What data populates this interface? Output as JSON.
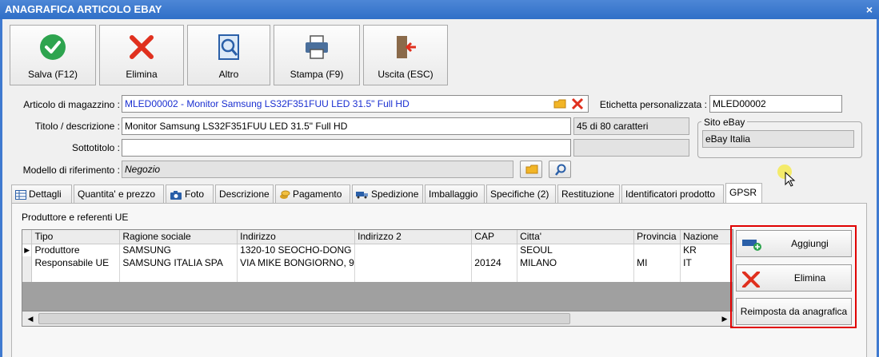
{
  "window": {
    "title": "ANAGRAFICA ARTICOLO EBAY",
    "close": "×"
  },
  "toolbar": {
    "save": "Salva (F12)",
    "delete": "Elimina",
    "other": "Altro",
    "print": "Stampa (F9)",
    "exit": "Uscita (ESC)"
  },
  "form": {
    "article_label": "Articolo di magazzino :",
    "article_value": "MLED00002 - Monitor Samsung LS32F351FUU LED 31.5\" Full HD",
    "custom_label_label": "Etichetta personalizzata :",
    "custom_label_value": "MLED00002",
    "title_label": "Titolo / descrizione :",
    "title_value": "Monitor Samsung LS32F351FUU LED 31.5\" Full HD",
    "char_count": "45 di 80 caratteri",
    "subtitle_label": "Sottotitolo :",
    "subtitle_value": "",
    "model_label": "Modello di riferimento :",
    "model_value": "Negozio",
    "site_group": "Sito eBay",
    "site_value": "eBay Italia"
  },
  "tabs": [
    "Dettagli",
    "Quantita' e prezzo",
    "Foto",
    "Descrizione",
    "Pagamento",
    "Spedizione",
    "Imballaggio",
    "Specifiche (2)",
    "Restituzione",
    "Identificatori prodotto",
    "GPSR"
  ],
  "gpsr": {
    "section_title": "Produttore e referenti UE",
    "columns": [
      "Tipo",
      "Ragione sociale",
      "Indirizzo",
      "Indirizzo 2",
      "CAP",
      "Citta'",
      "Provincia",
      "Nazione"
    ],
    "rows": [
      [
        "Produttore",
        "SAMSUNG",
        "1320-10 SEOCHO-DONG",
        "",
        "",
        "SEOUL",
        "",
        "KR"
      ],
      [
        "Responsabile UE",
        "SAMSUNG ITALIA SPA",
        "VIA MIKE BONGIORNO, 9",
        "",
        "20124",
        "MILANO",
        "MI",
        "IT"
      ]
    ],
    "buttons": {
      "add": "Aggiungi",
      "delete": "Elimina",
      "reset": "Reimposta da anagrafica"
    }
  },
  "colors": {
    "title_bar": "#2f6fc7",
    "highlight": "#e00000",
    "link_text": "#1a2fd1"
  }
}
